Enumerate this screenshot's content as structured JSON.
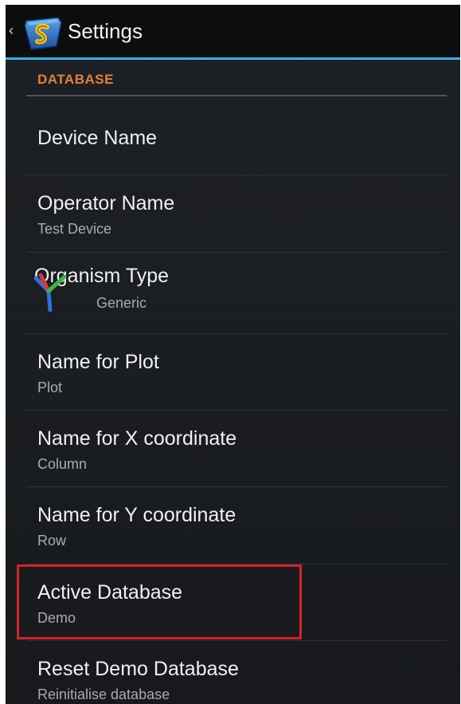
{
  "action_bar": {
    "title": "Settings",
    "up_caret": "‹"
  },
  "category": {
    "label": "DATABASE"
  },
  "preferences": [
    {
      "title": "Device Name",
      "summary": ""
    },
    {
      "title": "Operator Name",
      "summary": "Test Device"
    },
    {
      "title": "Organism Type",
      "summary": "Generic",
      "icon": "organism-y-icon"
    },
    {
      "title": "Name for Plot",
      "summary": "Plot"
    },
    {
      "title": "Name for X coordinate",
      "summary": "Column"
    },
    {
      "title": "Name for Y coordinate",
      "summary": "Row"
    },
    {
      "title": "Active Database",
      "summary": "Demo",
      "highlighted": true
    },
    {
      "title": "Reset Demo Database",
      "summary": "Reinitialise database"
    }
  ],
  "colors": {
    "accent": "#33b5e5",
    "category": "#e0803a",
    "highlight": "#d8202a",
    "background": "#1b1e22"
  }
}
